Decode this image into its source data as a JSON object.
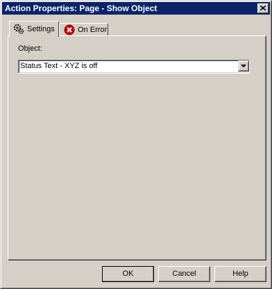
{
  "window": {
    "title": "Action Properties: Page - Show Object"
  },
  "tabs": [
    {
      "label": "Settings",
      "icon": "gear-icon",
      "selected": true
    },
    {
      "label": "On Error",
      "icon": "error-icon",
      "selected": false
    }
  ],
  "settings": {
    "object_label": "Object:",
    "object_value": "Status Text - XYZ is off"
  },
  "buttons": {
    "ok": "OK",
    "cancel": "Cancel",
    "help": "Help"
  },
  "colors": {
    "titlebar": "#0a246a",
    "face": "#d4d0c8",
    "error_icon": "#d40000"
  }
}
